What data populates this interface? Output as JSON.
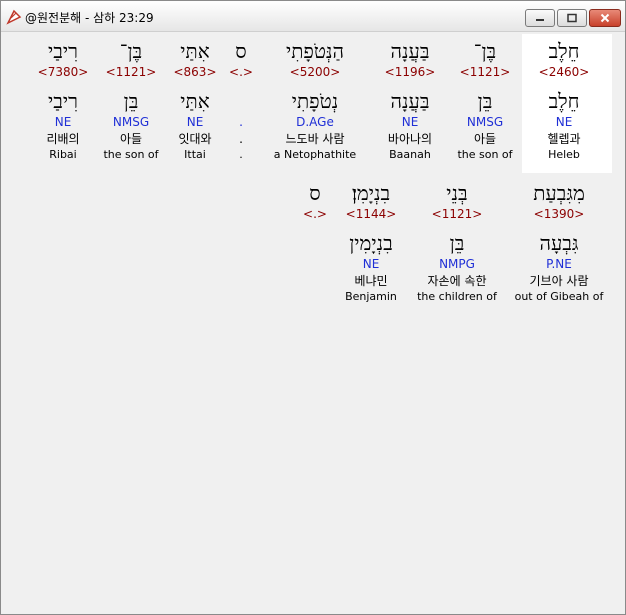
{
  "window": {
    "title": "@원전분해 - 삼하 23:29"
  },
  "rows": [
    {
      "words": [
        {
          "heb": "חֵלֶב",
          "strong": "<2460>",
          "lemma": "חֵלֶב",
          "pos": "NE",
          "kor": "헬렙과",
          "eng": "Heleb"
        },
        {
          "heb": "בֶּן־",
          "strong": "<1121>",
          "lemma": "בֵּן",
          "pos": "NMSG",
          "kor": "아들",
          "eng": "the son of"
        },
        {
          "heb": "בַּעֲנָה",
          "strong": "<1196>",
          "lemma": "בַּעֲנָה",
          "pos": "NE",
          "kor": "바아나의",
          "eng": "Baanah"
        },
        {
          "heb": "הַנְּטֹפָתִי",
          "strong": "<5200>",
          "lemma": "נְטֹפָתִי",
          "pos": "D.AGe",
          "kor": "느도바 사람",
          "eng": "a Netophathite"
        },
        {
          "heb": "ס",
          "strong": "<.>",
          "lemma": "",
          "pos": ".",
          "kor": ".",
          "eng": "."
        },
        {
          "heb": "אִתַּי",
          "strong": "<863>",
          "lemma": "אִתַּי",
          "pos": "NE",
          "kor": "잇대와",
          "eng": "Ittai"
        },
        {
          "heb": "בֶּן־",
          "strong": "<1121>",
          "lemma": "בֵּן",
          "pos": "NMSG",
          "kor": "아들",
          "eng": "the son of"
        },
        {
          "heb": "רִיבַי",
          "strong": "<7380>",
          "lemma": "רִיבַי",
          "pos": "NE",
          "kor": "리배의",
          "eng": "Ribai"
        }
      ]
    },
    {
      "words": [
        {
          "heb": "מִגִּבְעַת",
          "strong": "<1390>",
          "lemma": "גִּבְעָה",
          "pos": "P.NE",
          "kor": "기브아 사람",
          "eng": "out of Gibeah of"
        },
        {
          "heb": "בְּנֵי",
          "strong": "<1121>",
          "lemma": "בֵּן",
          "pos": "NMPG",
          "kor": "자손에 속한",
          "eng": "the children of"
        },
        {
          "heb": "בִנְיָמִן׃",
          "strong": "<1144>",
          "lemma": "בִנְיָמִין",
          "pos": "NE",
          "kor": "베냐민",
          "eng": "Benjamin"
        },
        {
          "heb": "ס",
          "strong": "<.>",
          "lemma": "",
          "pos": "",
          "kor": "",
          "eng": ""
        }
      ]
    }
  ]
}
